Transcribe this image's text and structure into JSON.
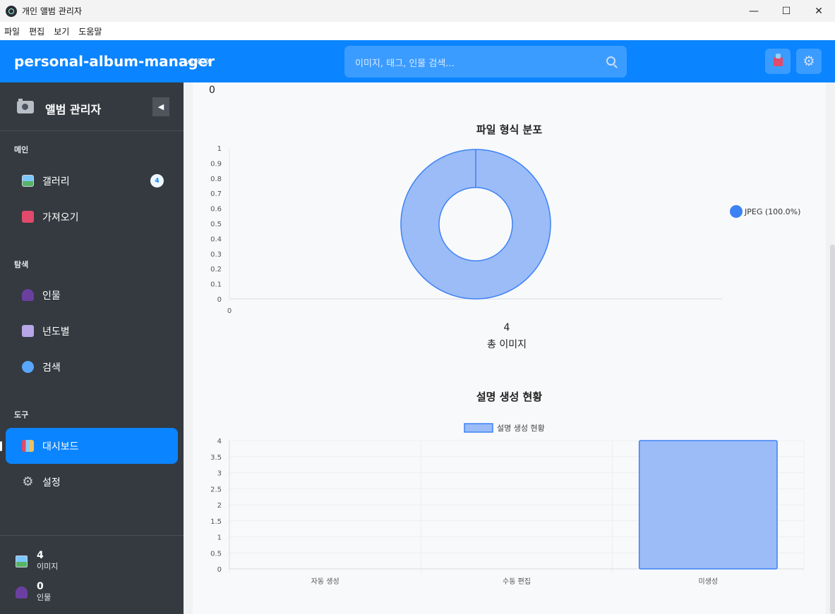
{
  "window": {
    "title": "개인 앨범 관리자",
    "controls": {
      "minimize": "—",
      "maximize": "☐",
      "close": "✕"
    }
  },
  "menu": [
    "파일",
    "편집",
    "보기",
    "도움말"
  ],
  "header": {
    "brand": "personal-album-manager",
    "version": "v1.0.0",
    "search_placeholder": "이미지, 태그, 인물 검색...",
    "brand_color": "#0a84ff"
  },
  "sidebar": {
    "title": "앨범 관리자",
    "collapse_glyph": "◀",
    "sections": {
      "main": "메인",
      "explore": "탐색",
      "tools": "도구"
    },
    "items": [
      {
        "label": "갤러리",
        "icon": "gallery-icon",
        "badge": "4"
      },
      {
        "label": "가져오기",
        "icon": "import-icon"
      },
      {
        "label": "인물",
        "icon": "person-icon"
      },
      {
        "label": "년도별",
        "icon": "calendar-icon"
      },
      {
        "label": "검색",
        "icon": "search-icon"
      },
      {
        "label": "대시보드",
        "icon": "chart-icon",
        "active": true
      },
      {
        "label": "설정",
        "icon": "gear-icon"
      }
    ],
    "stats": [
      {
        "value": "4",
        "label": "이미지"
      },
      {
        "value": "0",
        "label": "인물"
      }
    ]
  },
  "main": {
    "top_value": "0",
    "gear_glyph": "⚙"
  },
  "chart_data": [
    {
      "type": "pie",
      "title": "파일 형식 분포",
      "slices": [
        {
          "label": "JPEG (100.0%)",
          "value": 4,
          "color": "#3d82f5"
        }
      ],
      "doughnut": true,
      "legend": "right",
      "y_ticks": [
        "0",
        "0.1",
        "0.2",
        "0.3",
        "0.4",
        "0.5",
        "0.6",
        "0.7",
        "0.8",
        "0.9",
        "1"
      ],
      "x_ticks": [
        "0"
      ],
      "center_value": "4",
      "center_label": "총 이미지"
    },
    {
      "type": "bar",
      "title": "설명 생성 현황",
      "categories": [
        "자동 생성",
        "수동 편집",
        "미생성"
      ],
      "series": [
        {
          "name": "설명 생성 현황",
          "values": [
            0,
            0,
            4
          ]
        }
      ],
      "ylim": [
        0,
        4
      ],
      "y_ticks": [
        "0",
        "0.5",
        "1",
        "1.5",
        "2",
        "2.5",
        "3",
        "3.5",
        "4"
      ],
      "legend": "top",
      "grid": true,
      "fill": "#9bbcf7",
      "stroke": "#3d82f5"
    }
  ]
}
